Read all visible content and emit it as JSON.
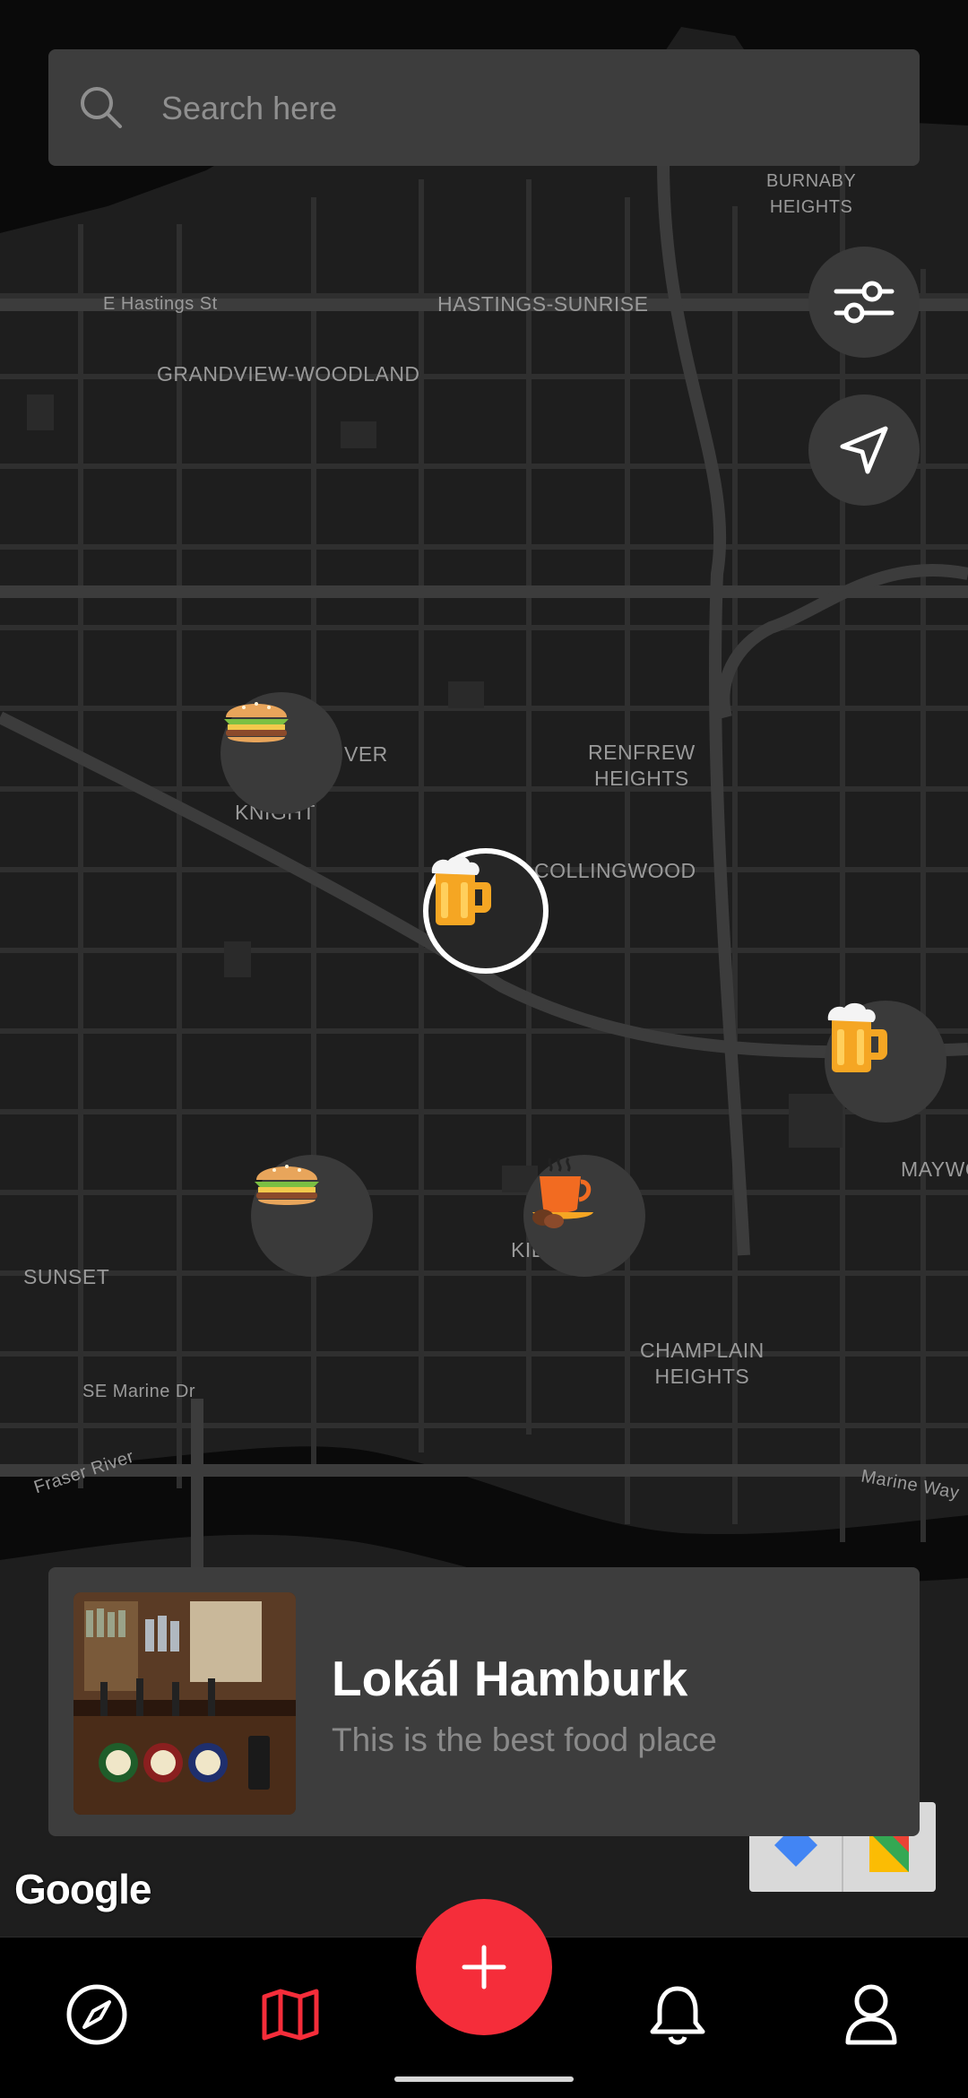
{
  "search": {
    "placeholder": "Search here"
  },
  "map": {
    "labels": {
      "burnaby_heights": "BURNABY\nHEIGHTS",
      "e_hastings": "E Hastings St",
      "hastings_sunrise": "HASTINGS-SUNRISE",
      "grandview": "GRANDVIEW-WOODLAND",
      "renfrew": "RENFREW\nHEIGHTS",
      "collingwood": "COLLINGWOOD",
      "knight": "KNIGHT",
      "ver": "VER",
      "maywood": "MAYWO",
      "sunset": "SUNSET",
      "kil": "KIL",
      "champlain": "CHAMPLAIN\nHEIGHTS",
      "se_marine": "SE Marine Dr",
      "fraser_river": "Fraser River",
      "marine_way": "Marine Way"
    },
    "attribution": "Google",
    "markers": [
      {
        "type": "burger",
        "icon": "burger-icon"
      },
      {
        "type": "beer",
        "icon": "beer-icon",
        "selected": true
      },
      {
        "type": "beer",
        "icon": "beer-icon"
      },
      {
        "type": "burger",
        "icon": "burger-icon"
      },
      {
        "type": "coffee",
        "icon": "coffee-icon"
      }
    ]
  },
  "controls": {
    "filter_icon": "sliders-icon",
    "locate_icon": "navigation-arrow-icon"
  },
  "place_card": {
    "title": "Lokál Hamburk",
    "subtitle": "This is the best food place"
  },
  "bottom_nav": {
    "items": [
      {
        "name": "explore",
        "icon": "compass-icon"
      },
      {
        "name": "map",
        "icon": "map-icon",
        "active": true
      },
      {
        "name": "add",
        "icon": "plus-icon"
      },
      {
        "name": "notifications",
        "icon": "bell-icon"
      },
      {
        "name": "profile",
        "icon": "user-icon"
      }
    ]
  },
  "colors": {
    "accent": "#f52d3a",
    "surface": "#3d3d3d",
    "map_bg": "#1e1e1e",
    "road": "#333333"
  }
}
